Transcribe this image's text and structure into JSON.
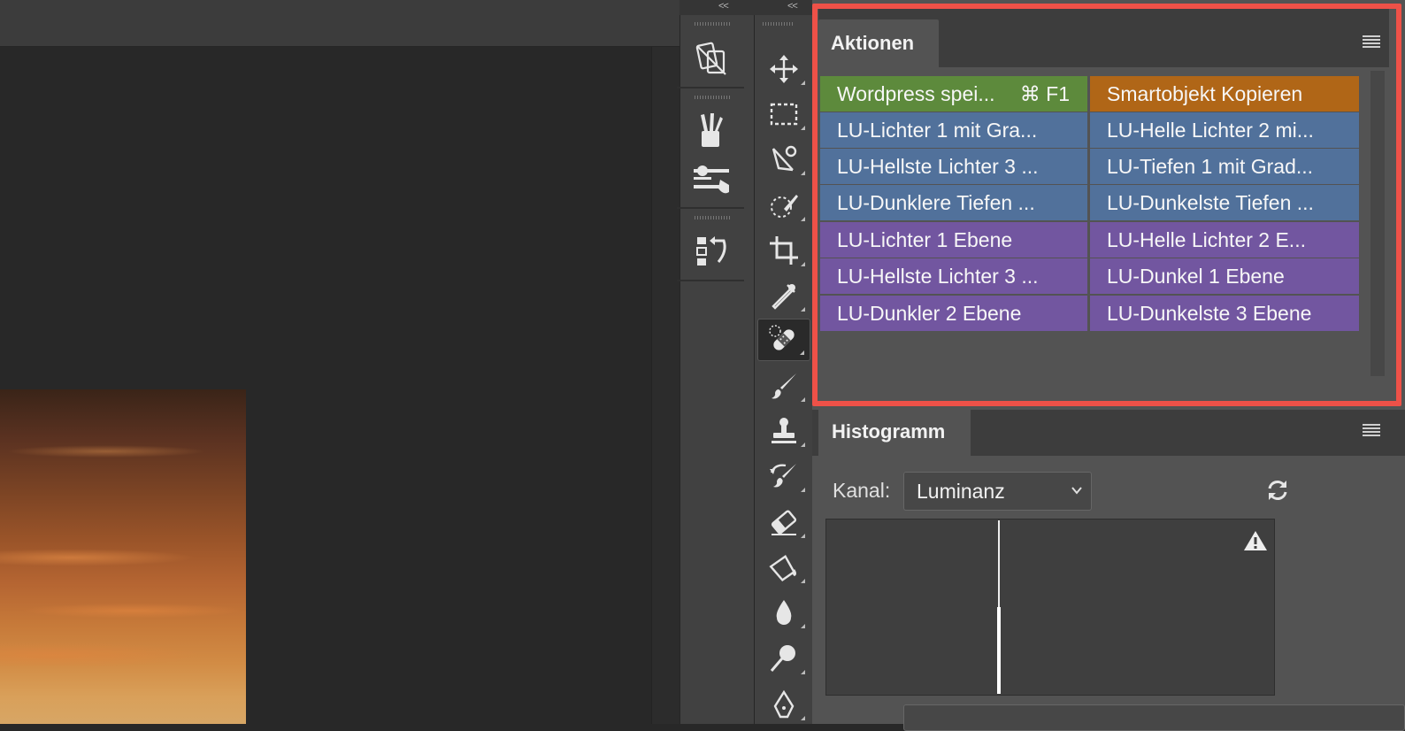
{
  "panel_dock": {
    "collapse_glyph": "<<"
  },
  "tool_dock": {
    "collapse_glyph": "<<"
  },
  "dock_icons": [
    "artboard-icon",
    "brush-presets-icon",
    "adjustments-icon",
    "history-icon"
  ],
  "tools": [
    "move-icon",
    "marquee-icon",
    "lasso-icon",
    "quick-selection-icon",
    "crop-icon",
    "eyedropper-icon",
    "healing-brush-icon",
    "brush-icon",
    "clone-stamp-icon",
    "history-brush-icon",
    "eraser-icon",
    "paint-bucket-icon",
    "blur-icon",
    "dodge-icon",
    "pen-icon"
  ],
  "actions_panel": {
    "title": "Aktionen",
    "menu_icon": "panel-menu-icon",
    "highlight_color": "#ee5148",
    "items": [
      {
        "label": "Wordpress spei...",
        "shortcut": "⌘ F1",
        "color": "#5d8a3c"
      },
      {
        "label": "Smartobjekt Kopieren",
        "color": "#b06617"
      },
      {
        "label": "LU-Lichter 1 mit Gra...",
        "color": "#51719b"
      },
      {
        "label": "LU-Helle Lichter 2 mi...",
        "color": "#51719b"
      },
      {
        "label": "LU-Hellste Lichter 3 ...",
        "color": "#51719b"
      },
      {
        "label": "LU-Tiefen 1 mit Grad...",
        "color": "#51719b"
      },
      {
        "label": "LU-Dunklere Tiefen ...",
        "color": "#51719b"
      },
      {
        "label": "LU-Dunkelste Tiefen ...",
        "color": "#51719b"
      },
      {
        "label": "LU-Lichter 1 Ebene",
        "color": "#7256a0"
      },
      {
        "label": "LU-Helle Lichter 2 E...",
        "color": "#7256a0"
      },
      {
        "label": "LU-Hellste Lichter 3 ...",
        "color": "#7256a0"
      },
      {
        "label": "LU-Dunkel 1 Ebene",
        "color": "#7256a0"
      },
      {
        "label": "LU-Dunkler 2 Ebene",
        "color": "#7256a0"
      },
      {
        "label": "LU-Dunkelste 3 Ebene",
        "color": "#7256a0"
      }
    ]
  },
  "histogram_panel": {
    "title": "Histogramm",
    "channel_label": "Kanal:",
    "channel_value": "Luminanz",
    "refresh_icon": "refresh-icon",
    "warning_icon": "warning-icon"
  }
}
